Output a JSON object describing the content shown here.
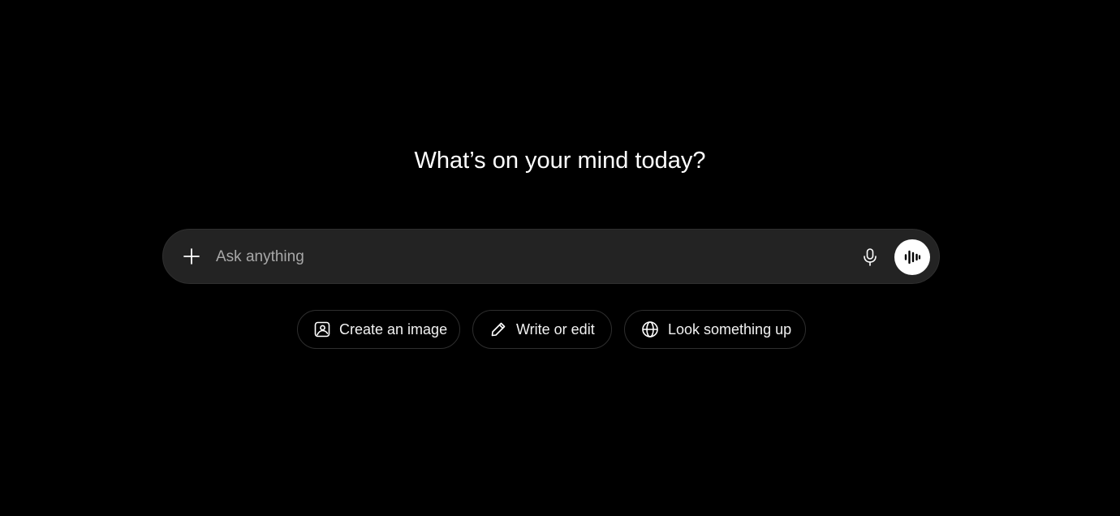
{
  "main": {
    "heading": "What’s on your mind today?"
  },
  "composer": {
    "input_value": "",
    "input_placeholder": "Ask anything",
    "icons": {
      "attach": "plus-icon",
      "dictate": "microphone-icon",
      "voice_mode": "sound-wave-icon"
    }
  },
  "suggestions": [
    {
      "label": "Create an image",
      "icon": "image-icon"
    },
    {
      "label": "Write or edit",
      "icon": "pencil-icon"
    },
    {
      "label": "Look something up",
      "icon": "globe-icon"
    }
  ],
  "colors": {
    "background": "#000000",
    "composer_bg": "#232323",
    "voice_button_bg": "#ffffff",
    "text": "#ffffff",
    "placeholder": "#a8a8a8"
  }
}
